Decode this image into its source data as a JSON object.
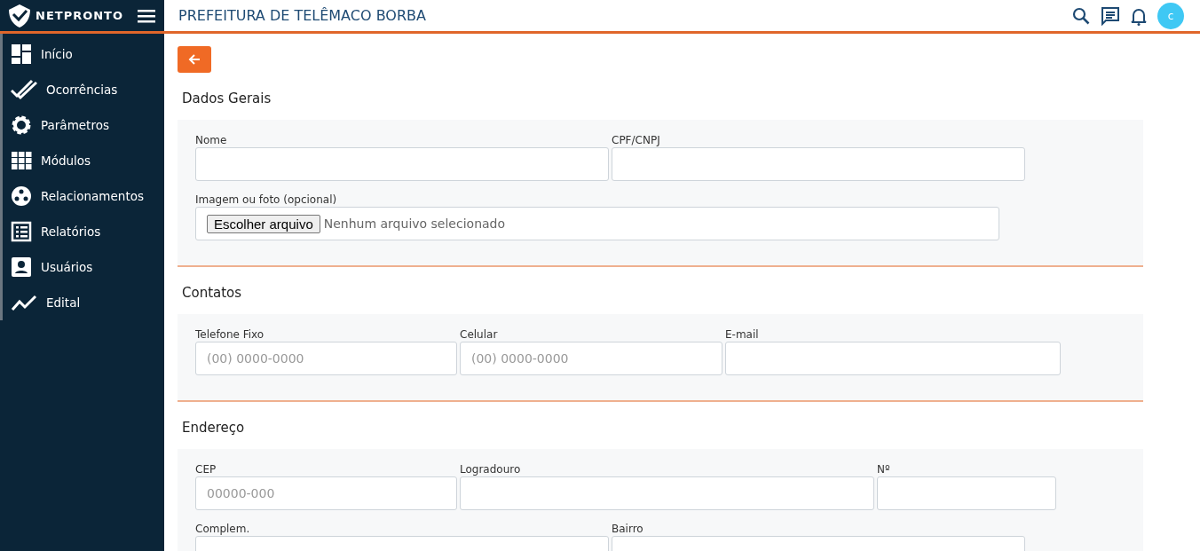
{
  "brand": {
    "name": "NETPRONTO"
  },
  "header": {
    "title": "PREFEITURA DE TELÊMACO BORBA",
    "avatar": "c"
  },
  "sidebar": {
    "items": [
      {
        "label": "Início"
      },
      {
        "label": "Ocorrências"
      },
      {
        "label": "Parâmetros"
      },
      {
        "label": "Módulos"
      },
      {
        "label": "Relacionamentos"
      },
      {
        "label": "Relatórios"
      },
      {
        "label": "Usuários"
      },
      {
        "label": "Edital"
      }
    ]
  },
  "sections": [
    {
      "title": "Dados Gerais",
      "rows": [
        [
          {
            "label": "Nome",
            "kind": "text"
          },
          {
            "label": "CPF/CNPJ",
            "kind": "text"
          }
        ],
        [
          {
            "label": "Imagem ou foto (opcional)",
            "kind": "file",
            "button": "Escolher arquivo",
            "value": "Nenhum arquivo selecionado"
          }
        ]
      ]
    },
    {
      "title": "Contatos",
      "rows": [
        [
          {
            "label": "Telefone Fixo",
            "kind": "text",
            "placeholder": "(00) 0000-0000"
          },
          {
            "label": "Celular",
            "kind": "text",
            "placeholder": "(00) 0000-0000"
          },
          {
            "label": "E-mail",
            "kind": "text"
          }
        ]
      ]
    },
    {
      "title": "Endereço",
      "rows": [
        [
          {
            "label": "CEP",
            "kind": "text",
            "placeholder": "00000-000"
          },
          {
            "label": "Logradouro",
            "kind": "text"
          },
          {
            "label": "Nº",
            "kind": "text"
          }
        ],
        [
          {
            "label": "Complem.",
            "kind": "text"
          },
          {
            "label": "Bairro",
            "kind": "text"
          }
        ]
      ]
    }
  ]
}
